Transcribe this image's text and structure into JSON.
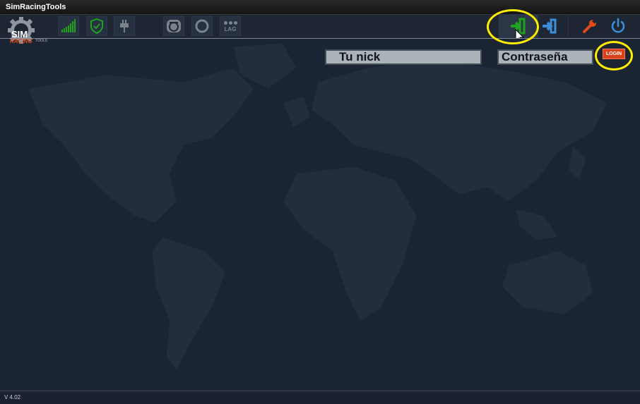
{
  "window": {
    "title": "SimRacingTools"
  },
  "logo": {
    "main": "SIM",
    "sub": "RACING",
    "tag": "TOOLS"
  },
  "toolbar": {
    "lag_label": "LAG",
    "icons": [
      "signal-bars-icon",
      "shield-check-icon",
      "plug-icon",
      "steering-wheel-icon",
      "ring-icon",
      "lag-icon",
      "login-arrow-icon",
      "import-arrow-icon",
      "wrench-icon",
      "power-icon"
    ]
  },
  "login_form": {
    "nick_value": "Tu nick",
    "password_value": "Contraseña",
    "login_label": "LOGIN"
  },
  "status": {
    "version": "V 4.02"
  },
  "colors": {
    "accent_green": "#1fa31f",
    "accent_blue": "#3d8fdb",
    "accent_orange": "#e24a1b",
    "highlight": "#ffee00"
  }
}
